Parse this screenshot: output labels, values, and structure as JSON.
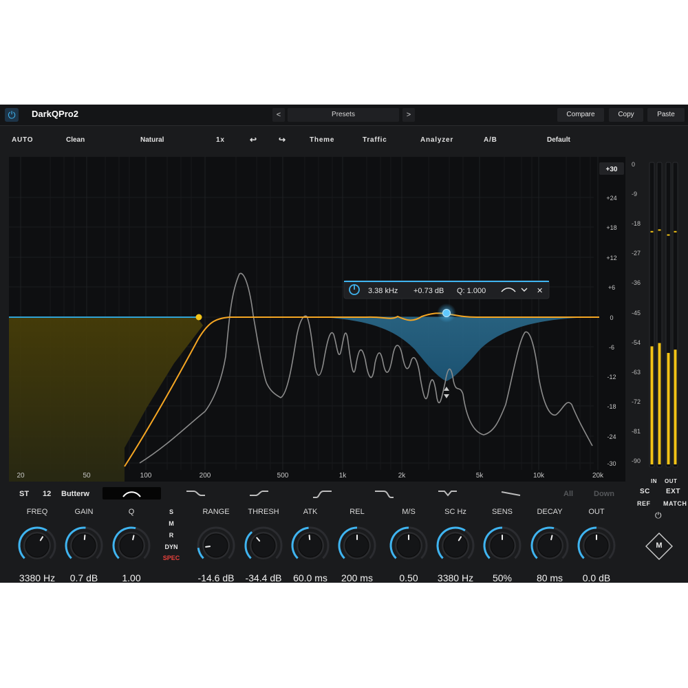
{
  "app": {
    "title": "DarkQPro2"
  },
  "toolbar": {
    "prev_label": "<",
    "next_label": ">",
    "preset_label": "Presets",
    "compare_label": "Compare",
    "copy_label": "Copy",
    "paste_label": "Paste"
  },
  "options": {
    "auto": "AUTO",
    "clean": "Clean",
    "natural": "Natural",
    "zoom": "1x",
    "undo_glyph": "↩",
    "redo_glyph": "↪",
    "theme": "Theme",
    "traffic": "Traffic",
    "analyzer": "Analyzer",
    "ab": "A/B",
    "default": "Default"
  },
  "graph": {
    "db_range_label": "+30",
    "db_labels": [
      "+24",
      "+18",
      "+12",
      "+6",
      "0",
      "-6",
      "-12",
      "-18",
      "-24",
      "-30"
    ],
    "freq_labels": [
      "20",
      "50",
      "100",
      "200",
      "500",
      "1k",
      "2k",
      "5k",
      "10k",
      "20k"
    ],
    "popup": {
      "freq": "3.38 kHz",
      "gain": "+0.73 dB",
      "q": "Q: 1.000",
      "close": "✕"
    },
    "colors": {
      "curve": "#f5a623",
      "band": "#3fb4f0",
      "node_hp": "#f2c318",
      "node_band": "#3fb4f0",
      "flat_line": "#2fa3d6"
    }
  },
  "band": {
    "stereo": "ST",
    "slope": "12",
    "type": "Butterw",
    "all": "All",
    "down": "Down"
  },
  "knobs": {
    "freq": {
      "label": "FREQ",
      "value": "3380 Hz",
      "level": 0.62
    },
    "gain": {
      "label": "GAIN",
      "value": "0.7 dB",
      "level": 0.52
    },
    "q": {
      "label": "Q",
      "value": "1.00",
      "level": 0.55
    },
    "range": {
      "label": "RANGE",
      "value": "-14.6 dB",
      "level": 0.14
    },
    "thresh": {
      "label": "THRESH",
      "value": "-34.4 dB",
      "level": 0.35
    },
    "atk": {
      "label": "ATK",
      "value": "60.0 ms",
      "level": 0.48
    },
    "rel": {
      "label": "REL",
      "value": "200 ms",
      "level": 0.5
    },
    "ms": {
      "label": "M/S",
      "value": "0.50",
      "level": 0.5
    },
    "schz": {
      "label": "SC Hz",
      "value": "3380 Hz",
      "level": 0.62
    },
    "sens": {
      "label": "SENS",
      "value": "50%",
      "level": 0.5
    },
    "decay": {
      "label": "DECAY",
      "value": "80 ms",
      "level": 0.55
    },
    "out": {
      "label": "OUT",
      "value": "0.0 dB",
      "level": 0.5
    }
  },
  "mode": {
    "s": "S",
    "m": "M",
    "r": "R",
    "dyn": "DYN",
    "spec": "SPEC",
    "spec_color": "#e8413c"
  },
  "meters": {
    "scale": [
      "0",
      "-9",
      "-18",
      "-27",
      "-36",
      "-45",
      "-54",
      "-63",
      "-72",
      "-81",
      "-90"
    ],
    "in_label": "IN",
    "out_label": "OUT",
    "sc": "SC",
    "ext": "EXT",
    "ref": "REF",
    "match": "MATCH",
    "logo": "M",
    "levels_db": [
      -55,
      -54,
      -57,
      -56
    ],
    "peaks_db": [
      -20,
      -19.5,
      -21,
      -20
    ]
  }
}
